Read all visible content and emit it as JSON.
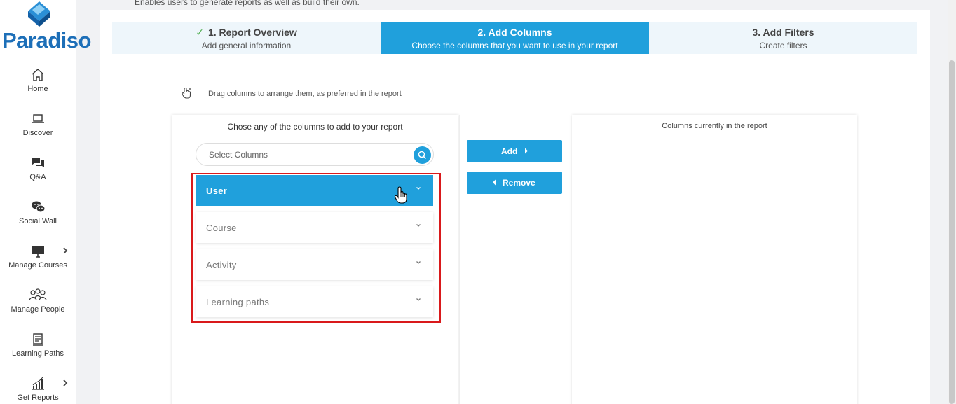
{
  "app": {
    "logo_text": "Paradiso",
    "accent_color": "#20a0dc",
    "highlight_color": "#d9191b"
  },
  "page": {
    "description": "Enables users to generate reports as well as build their own."
  },
  "sidebar": {
    "items": [
      {
        "label": "Home",
        "icon": "home-icon"
      },
      {
        "label": "Discover",
        "icon": "laptop-icon"
      },
      {
        "label": "Q&A",
        "icon": "chat-bubbles-icon"
      },
      {
        "label": "Social Wall",
        "icon": "wechat-icon"
      },
      {
        "label": "Manage Courses",
        "icon": "monitor-icon",
        "has_submenu": true
      },
      {
        "label": "Manage People",
        "icon": "people-icon"
      },
      {
        "label": "Learning Paths",
        "icon": "book-icon"
      },
      {
        "label": "Get Reports",
        "icon": "bar-chart-icon",
        "has_submenu": true
      }
    ]
  },
  "wizard": {
    "steps": [
      {
        "title": "1. Report Overview",
        "subtitle": "Add general information",
        "completed": true
      },
      {
        "title": "2. Add Columns",
        "subtitle": "Choose the columns that you want to use in your report",
        "active": true
      },
      {
        "title": "3. Add Filters",
        "subtitle": "Create filters"
      }
    ]
  },
  "hint": {
    "text": "Drag columns to arrange them, as preferred in the report"
  },
  "available_columns": {
    "title": "Chose any of the columns to add to your report",
    "search_placeholder": "Select Columns",
    "groups": [
      {
        "label": "User",
        "expanded": true
      },
      {
        "label": "Course"
      },
      {
        "label": "Activity"
      },
      {
        "label": "Learning paths"
      }
    ]
  },
  "actions": {
    "add_label": "Add",
    "remove_label": "Remove"
  },
  "report_columns": {
    "title": "Columns currently in the report"
  }
}
